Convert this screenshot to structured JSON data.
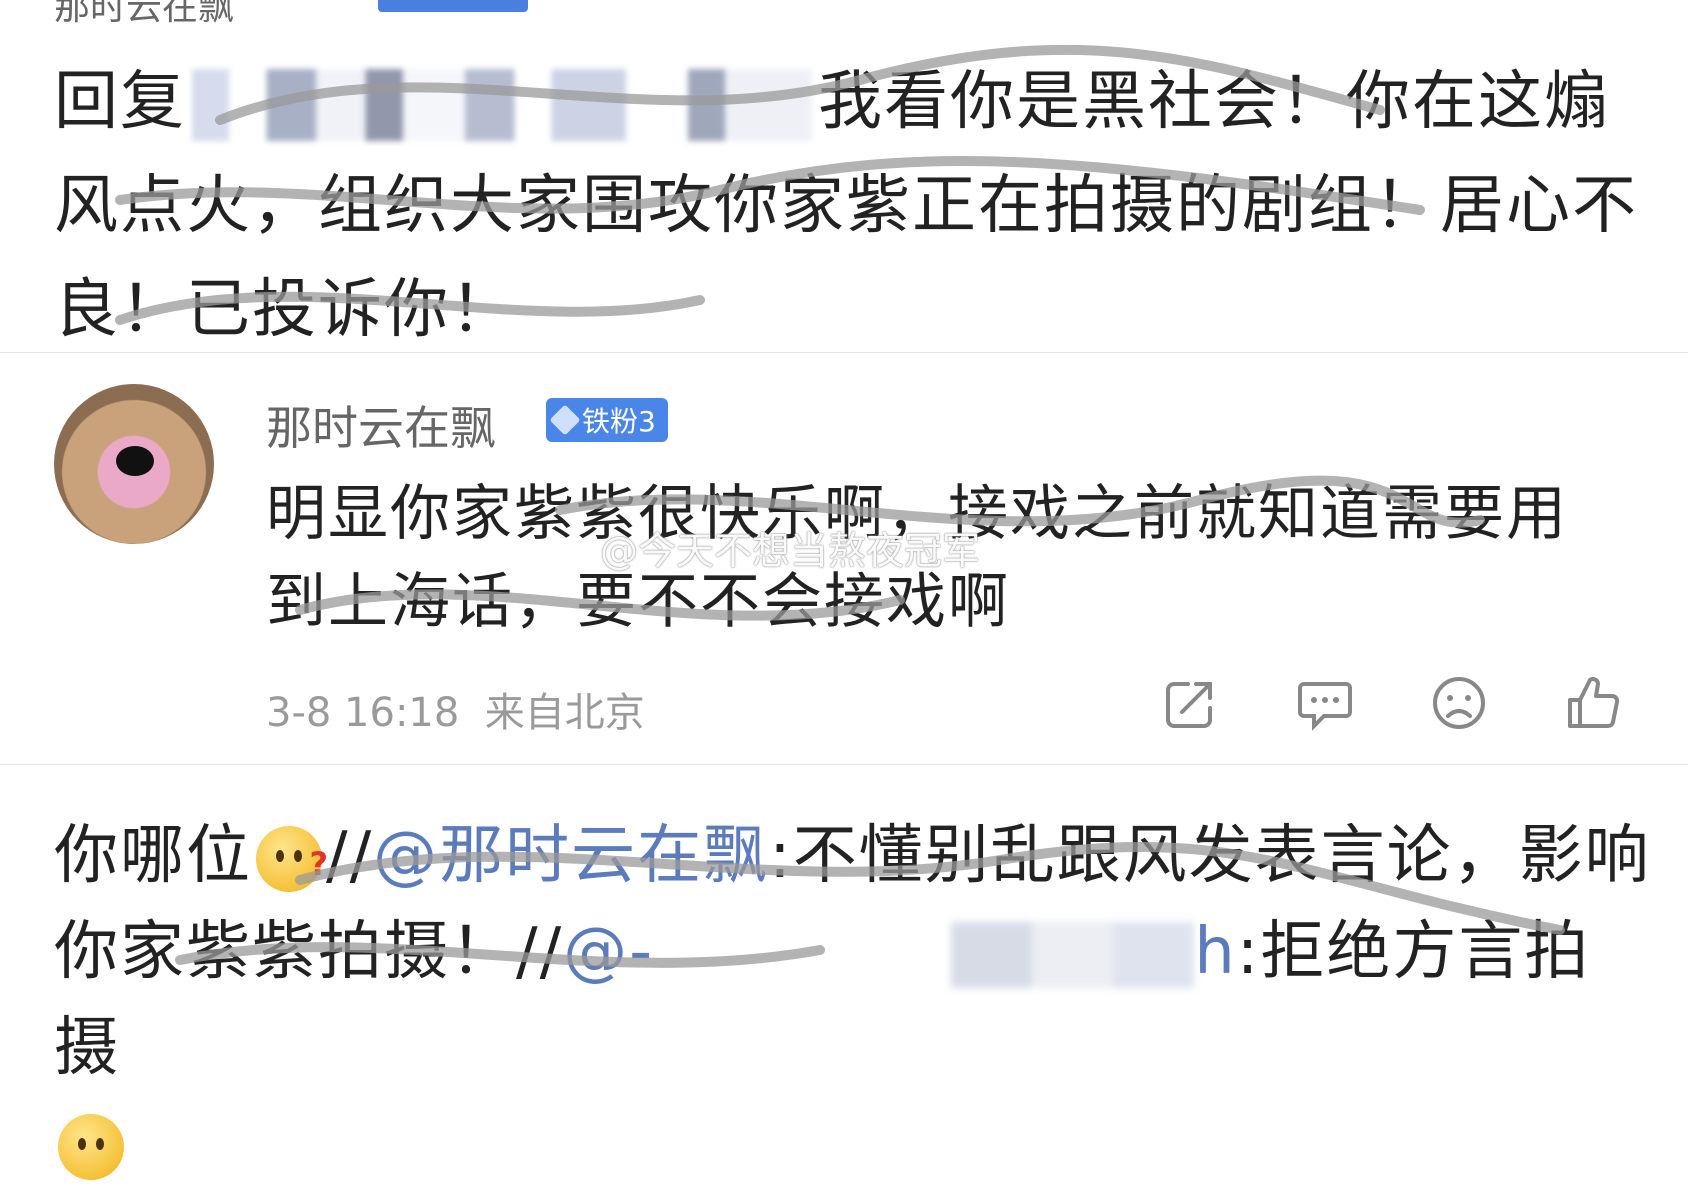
{
  "top": {
    "username": "那时云在飘"
  },
  "reply": {
    "prefix": "回复",
    "text_line": "我看你是黑社会！你在这煽风点火，组织大家围攻你家紫正在拍摄的剧组！居心不良！已投诉你！"
  },
  "comment": {
    "username": "那时云在飘",
    "badge": "铁粉3",
    "text": "明显你家紫紫很快乐啊，接戏之前就知道需要用到上海话，要不不会接戏啊",
    "date": "3-8 16:18",
    "location": "来自北京",
    "actions": {
      "share_icon": "share-icon",
      "comment_icon": "comment-icon",
      "dislike_icon": "sad-face-icon",
      "like_icon": "thumbs-up-icon"
    }
  },
  "watermark": "@今天不想当熬夜冠军",
  "bottom": {
    "part1": "你哪位",
    "sep1": "//",
    "mention1": "@那时云在飘",
    "text1": ":不懂别乱跟风发表言论，影响你家紫紫拍摄！",
    "sep2": "//",
    "mention2": "@-",
    "mention2_tail": "h",
    "text2": ":拒绝方言拍摄"
  }
}
